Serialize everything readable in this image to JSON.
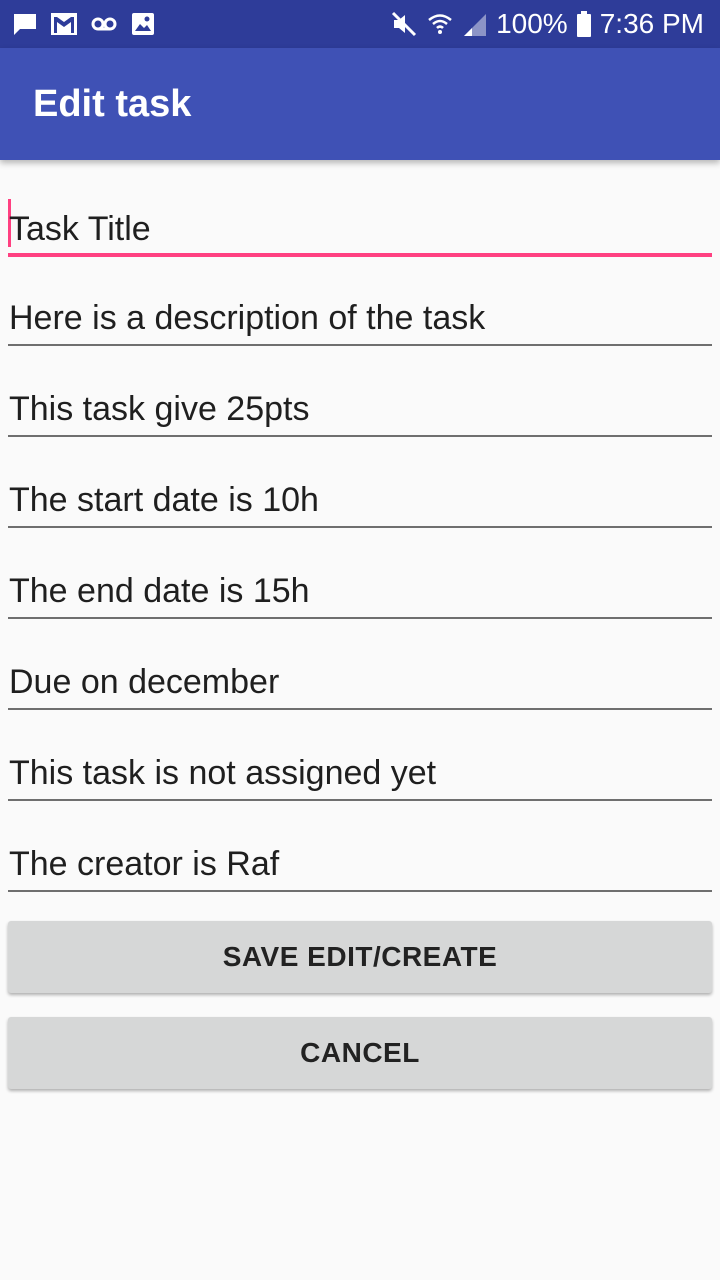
{
  "status_bar": {
    "battery_text": "100%",
    "time": "7:36 PM",
    "icons_left": [
      "message-icon",
      "gmail-icon",
      "voicemail-icon",
      "image-icon"
    ],
    "icons_right": [
      "mute-icon",
      "wifi-icon",
      "signal-icon",
      "battery-icon"
    ]
  },
  "app_bar": {
    "title": "Edit task",
    "color": "#3f51b5",
    "status_color": "#2e3c99"
  },
  "form": {
    "fields": [
      {
        "name": "title",
        "value": "Task Title",
        "focused": true
      },
      {
        "name": "description",
        "value": "Here is a description of the task"
      },
      {
        "name": "points",
        "value": "This task give 25pts"
      },
      {
        "name": "start-date",
        "value": "The start date is 10h"
      },
      {
        "name": "end-date",
        "value": "The end date is 15h"
      },
      {
        "name": "due",
        "value": "Due on december"
      },
      {
        "name": "assignee",
        "value": "This task is not assigned yet"
      },
      {
        "name": "creator",
        "value": "The creator is Raf"
      }
    ],
    "accent_color": "#ff4081"
  },
  "buttons": {
    "save_label": "SAVE EDIT/CREATE",
    "cancel_label": "CANCEL"
  }
}
